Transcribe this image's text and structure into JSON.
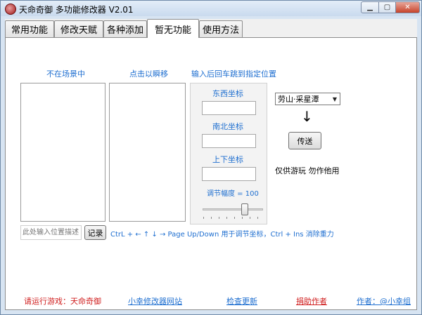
{
  "window": {
    "title": "天命奇御 多功能修改器 V2.01"
  },
  "tabs": [
    {
      "label": "常用功能"
    },
    {
      "label": "修改天赋"
    },
    {
      "label": "各种添加"
    },
    {
      "label": "暂无功能"
    },
    {
      "label": "使用方法"
    }
  ],
  "panel": {
    "list_left_header": "不在场景中",
    "list_right_header": "点击以瞬移",
    "teleport_hint": "输入后回车跳到指定位置",
    "coord_x_label": "东西坐标",
    "coord_x_value": "",
    "coord_y_label": "南北坐标",
    "coord_y_value": "",
    "coord_z_label": "上下坐标",
    "coord_z_value": "",
    "adjust_label": "调节幅度 = 100",
    "adjust_value": 100,
    "location_select": "劳山·采星潭",
    "arrow_glyph": "↓",
    "teleport_button": "传送",
    "disclaimer": "仅供游玩 勿作他用",
    "record_input_placeholder": "此处输入位置描述",
    "record_button": "记录",
    "hotkey_hint": "CtrL + ← ↑ ↓ → Page Up/Down 用于调节坐标，Ctrl + Ins 消除重力"
  },
  "footer": {
    "run_game": "请运行游戏：天命奇御",
    "website": "小幸修改器网站",
    "check_update": "检查更新",
    "donate": "捐助作者",
    "author": "作者：@小幸组"
  },
  "colors": {
    "accent_blue": "#1f6fd0",
    "warning_red": "#d01f1f"
  }
}
